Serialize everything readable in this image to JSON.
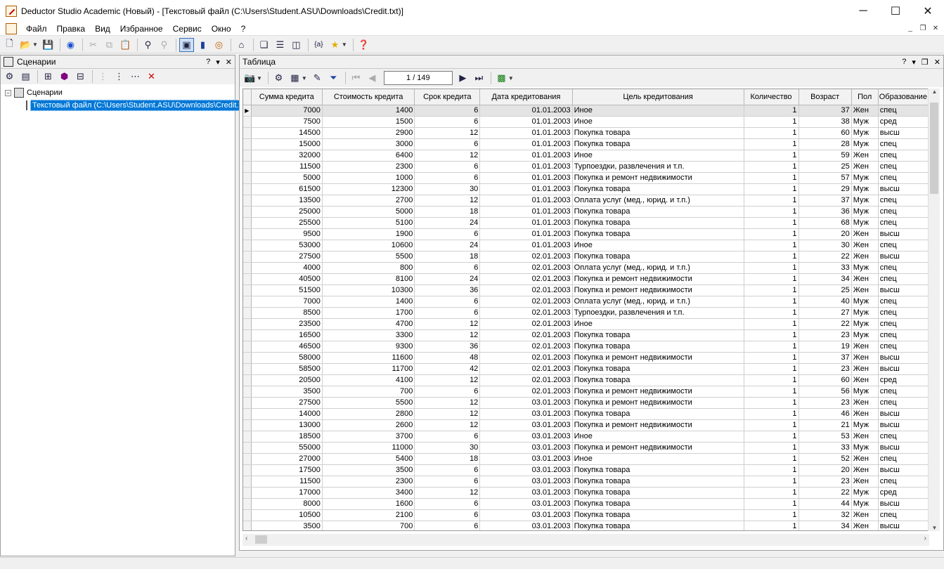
{
  "window": {
    "title": "Deductor Studio Academic (Новый) - [Текстовый файл (C:\\Users\\Student.ASU\\Downloads\\Credit.txt)]"
  },
  "menu": [
    "Файл",
    "Правка",
    "Вид",
    "Избранное",
    "Сервис",
    "Окно",
    "?"
  ],
  "left_panel": {
    "title": "Сценарии",
    "tree_root": "Сценарии",
    "tree_child": "Текстовый файл (C:\\Users\\Student.ASU\\Downloads\\Credit.txt)"
  },
  "right_panel": {
    "title": "Таблица",
    "page_indicator": "1 / 149"
  },
  "table": {
    "columns": [
      "Сумма кредита",
      "Стоимость кредита",
      "Срок кредита",
      "Дата кредитования",
      "Цель кредитования",
      "Количество",
      "Возраст",
      "Пол",
      "Образование"
    ],
    "rows": [
      [
        "7000",
        "1400",
        "6",
        "01.01.2003",
        "Иное",
        "1",
        "37",
        "Жен",
        "спец"
      ],
      [
        "7500",
        "1500",
        "6",
        "01.01.2003",
        "Иное",
        "1",
        "38",
        "Муж",
        "сред"
      ],
      [
        "14500",
        "2900",
        "12",
        "01.01.2003",
        "Покупка товара",
        "1",
        "60",
        "Муж",
        "высш"
      ],
      [
        "15000",
        "3000",
        "6",
        "01.01.2003",
        "Покупка товара",
        "1",
        "28",
        "Муж",
        "спец"
      ],
      [
        "32000",
        "6400",
        "12",
        "01.01.2003",
        "Иное",
        "1",
        "59",
        "Жен",
        "спец"
      ],
      [
        "11500",
        "2300",
        "6",
        "01.01.2003",
        "Турпоездки, развлечения и т.п.",
        "1",
        "25",
        "Жен",
        "спец"
      ],
      [
        "5000",
        "1000",
        "6",
        "01.01.2003",
        "Покупка и ремонт недвижимости",
        "1",
        "57",
        "Муж",
        "спец"
      ],
      [
        "61500",
        "12300",
        "30",
        "01.01.2003",
        "Покупка товара",
        "1",
        "29",
        "Муж",
        "высш"
      ],
      [
        "13500",
        "2700",
        "12",
        "01.01.2003",
        "Оплата услуг (мед., юрид. и т.п.)",
        "1",
        "37",
        "Муж",
        "спец"
      ],
      [
        "25000",
        "5000",
        "18",
        "01.01.2003",
        "Покупка товара",
        "1",
        "36",
        "Муж",
        "спец"
      ],
      [
        "25500",
        "5100",
        "24",
        "01.01.2003",
        "Покупка товара",
        "1",
        "68",
        "Муж",
        "спец"
      ],
      [
        "9500",
        "1900",
        "6",
        "01.01.2003",
        "Покупка товара",
        "1",
        "20",
        "Жен",
        "высш"
      ],
      [
        "53000",
        "10600",
        "24",
        "01.01.2003",
        "Иное",
        "1",
        "30",
        "Жен",
        "спец"
      ],
      [
        "27500",
        "5500",
        "18",
        "02.01.2003",
        "Покупка товара",
        "1",
        "22",
        "Жен",
        "высш"
      ],
      [
        "4000",
        "800",
        "6",
        "02.01.2003",
        "Оплата услуг (мед., юрид. и т.п.)",
        "1",
        "33",
        "Муж",
        "спец"
      ],
      [
        "40500",
        "8100",
        "24",
        "02.01.2003",
        "Покупка и ремонт недвижимости",
        "1",
        "34",
        "Жен",
        "спец"
      ],
      [
        "51500",
        "10300",
        "36",
        "02.01.2003",
        "Покупка и ремонт недвижимости",
        "1",
        "25",
        "Жен",
        "высш"
      ],
      [
        "7000",
        "1400",
        "6",
        "02.01.2003",
        "Оплата услуг (мед., юрид. и т.п.)",
        "1",
        "40",
        "Муж",
        "спец"
      ],
      [
        "8500",
        "1700",
        "6",
        "02.01.2003",
        "Турпоездки, развлечения и т.п.",
        "1",
        "27",
        "Муж",
        "спец"
      ],
      [
        "23500",
        "4700",
        "12",
        "02.01.2003",
        "Иное",
        "1",
        "22",
        "Муж",
        "спец"
      ],
      [
        "16500",
        "3300",
        "12",
        "02.01.2003",
        "Покупка товара",
        "1",
        "23",
        "Муж",
        "спец"
      ],
      [
        "46500",
        "9300",
        "36",
        "02.01.2003",
        "Покупка товара",
        "1",
        "19",
        "Жен",
        "спец"
      ],
      [
        "58000",
        "11600",
        "48",
        "02.01.2003",
        "Покупка и ремонт недвижимости",
        "1",
        "37",
        "Жен",
        "высш"
      ],
      [
        "58500",
        "11700",
        "42",
        "02.01.2003",
        "Покупка товара",
        "1",
        "23",
        "Жен",
        "высш"
      ],
      [
        "20500",
        "4100",
        "12",
        "02.01.2003",
        "Покупка товара",
        "1",
        "60",
        "Жен",
        "сред"
      ],
      [
        "3500",
        "700",
        "6",
        "02.01.2003",
        "Покупка и ремонт недвижимости",
        "1",
        "56",
        "Муж",
        "спец"
      ],
      [
        "27500",
        "5500",
        "12",
        "03.01.2003",
        "Покупка и ремонт недвижимости",
        "1",
        "23",
        "Жен",
        "спец"
      ],
      [
        "14000",
        "2800",
        "12",
        "03.01.2003",
        "Покупка товара",
        "1",
        "46",
        "Жен",
        "высш"
      ],
      [
        "13000",
        "2600",
        "12",
        "03.01.2003",
        "Покупка и ремонт недвижимости",
        "1",
        "21",
        "Муж",
        "высш"
      ],
      [
        "18500",
        "3700",
        "6",
        "03.01.2003",
        "Иное",
        "1",
        "53",
        "Жен",
        "спец"
      ],
      [
        "55000",
        "11000",
        "30",
        "03.01.2003",
        "Покупка и ремонт недвижимости",
        "1",
        "33",
        "Муж",
        "высш"
      ],
      [
        "27000",
        "5400",
        "18",
        "03.01.2003",
        "Иное",
        "1",
        "52",
        "Жен",
        "спец"
      ],
      [
        "17500",
        "3500",
        "6",
        "03.01.2003",
        "Покупка товара",
        "1",
        "20",
        "Жен",
        "высш"
      ],
      [
        "11500",
        "2300",
        "6",
        "03.01.2003",
        "Покупка товара",
        "1",
        "23",
        "Жен",
        "спец"
      ],
      [
        "17000",
        "3400",
        "12",
        "03.01.2003",
        "Покупка товара",
        "1",
        "22",
        "Муж",
        "сред"
      ],
      [
        "8000",
        "1600",
        "6",
        "03.01.2003",
        "Покупка товара",
        "1",
        "44",
        "Муж",
        "высш"
      ],
      [
        "10500",
        "2100",
        "6",
        "03.01.2003",
        "Покупка товара",
        "1",
        "32",
        "Жен",
        "спец"
      ],
      [
        "3500",
        "700",
        "6",
        "03.01.2003",
        "Покупка товара",
        "1",
        "34",
        "Жен",
        "высш"
      ]
    ]
  }
}
